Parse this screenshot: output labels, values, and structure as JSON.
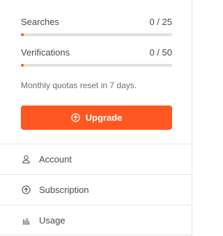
{
  "quotas": [
    {
      "label": "Searches",
      "count": "0 / 25",
      "used": 0,
      "limit": 25
    },
    {
      "label": "Verifications",
      "count": "0 / 50",
      "used": 0,
      "limit": 50
    }
  ],
  "note": "Monthly quotas reset in 7 days.",
  "upgrade": {
    "label": "Upgrade",
    "icon": "arrow-up-circle-icon"
  },
  "menu": [
    {
      "label": "Account",
      "icon": "user-icon"
    },
    {
      "label": "Subscription",
      "icon": "arrow-up-circle-icon"
    },
    {
      "label": "Usage",
      "icon": "bar-chart-icon"
    }
  ],
  "colors": {
    "accent": "#ff5722",
    "track": "#e0e0e0",
    "divider": "#e6e6e6"
  }
}
